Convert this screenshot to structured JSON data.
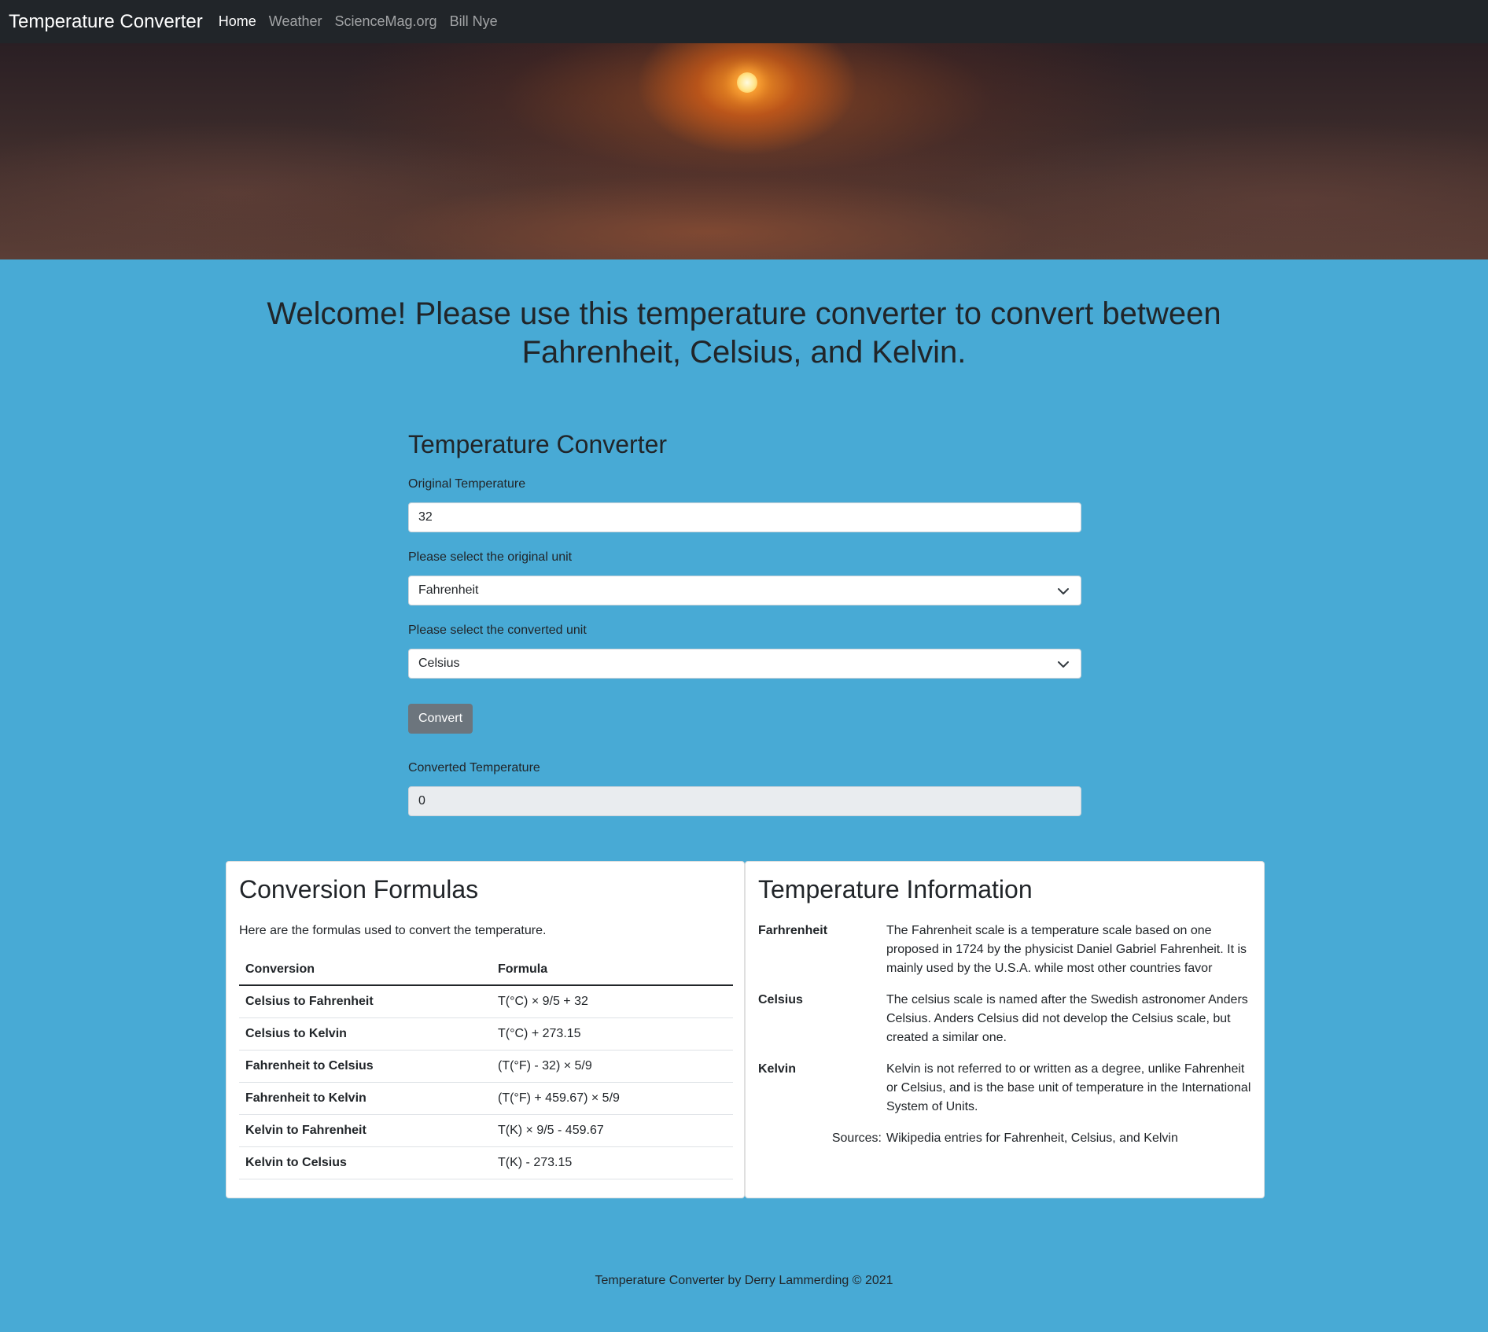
{
  "navbar": {
    "brand": "Temperature Converter",
    "links": [
      {
        "label": "Home"
      },
      {
        "label": "Weather"
      },
      {
        "label": "ScienceMag.org"
      },
      {
        "label": "Bill Nye"
      }
    ]
  },
  "welcome": "Welcome! Please use this temperature converter to convert between Fahrenheit, Celsius, and Kelvin.",
  "converter": {
    "title": "Temperature Converter",
    "original_label": "Original Temperature",
    "original_value": "32",
    "from_label": "Please select the original unit",
    "from_value": "Fahrenheit",
    "to_label": "Please select the converted unit",
    "to_value": "Celsius",
    "button": "Convert",
    "result_label": "Converted Temperature",
    "result_value": "0"
  },
  "formulas": {
    "title": "Conversion Formulas",
    "intro": "Here are the formulas used to convert the temperature.",
    "headers": [
      "Conversion",
      "Formula"
    ],
    "rows": [
      [
        "Celsius to Fahrenheit",
        "T(°C) × 9/5 + 32"
      ],
      [
        "Celsius to Kelvin",
        "T(°C) + 273.15"
      ],
      [
        "Fahrenheit to Celsius",
        "(T(°F) - 32) × 5/9"
      ],
      [
        "Fahrenheit to Kelvin",
        "(T(°F) + 459.67) × 5/9"
      ],
      [
        "Kelvin to Fahrenheit",
        "T(K) × 9/5 - 459.67"
      ],
      [
        "Kelvin to Celsius",
        "T(K) - 273.15"
      ]
    ]
  },
  "info": {
    "title": "Temperature Information",
    "entries": [
      {
        "term": "Farhrenheit",
        "desc": "The Fahrenheit scale is a temperature scale based on one proposed in 1724 by the physicist Daniel Gabriel Fahrenheit. It is mainly used by the U.S.A. while most other countries favor"
      },
      {
        "term": "Celsius",
        "desc": "The celsius scale is named after the Swedish astronomer Anders Celsius. Anders Celsius did not develop the Celsius scale, but created a similar one."
      },
      {
        "term": "Kelvin",
        "desc": "Kelvin is not referred to or written as a degree, unlike Fahrenheit or Celsius, and is the base unit of temperature in the International System of Units."
      }
    ],
    "sources_label": "Sources:",
    "sources_text": "Wikipedia entries for Fahrenheit, Celsius, and Kelvin"
  },
  "footer": "Temperature Converter by Derry Lammerding © 2021"
}
